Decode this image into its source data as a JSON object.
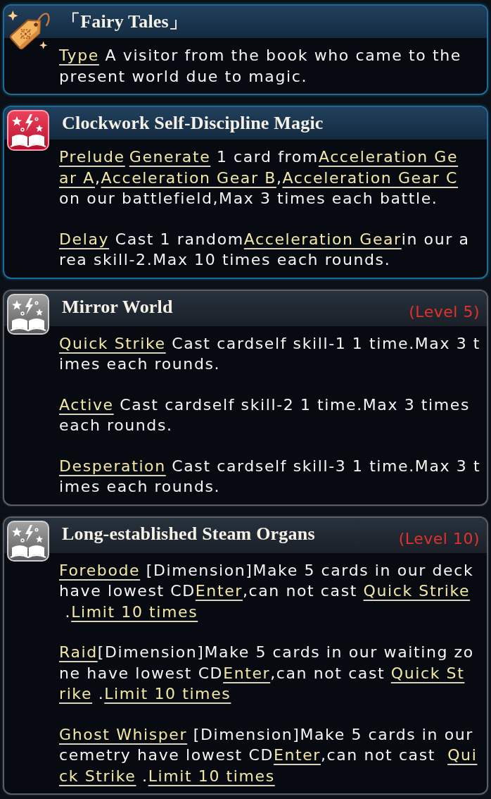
{
  "cards": [
    {
      "kind": "trait",
      "locked": false,
      "title": "「Fairy Tales」",
      "paragraphs": [
        {
          "lines": [
            [
              {
                "kind": "keyword",
                "text": "Type"
              },
              {
                "kind": "text",
                "text": " A visitor from the book who came to the"
              }
            ],
            [
              {
                "kind": "text",
                "text": "present world due to magic."
              }
            ]
          ]
        }
      ]
    },
    {
      "kind": "skill",
      "locked": false,
      "title": "Clockwork Self-Discipline Magic",
      "paragraphs": [
        {
          "lines": [
            [
              {
                "kind": "keyword",
                "text": "Prelude"
              },
              {
                "kind": "keyword",
                "text": "Generate"
              },
              {
                "kind": "text",
                "text": " 1 card from"
              },
              {
                "kind": "keyword",
                "text": "Acceleration Ge"
              }
            ],
            [
              {
                "kind": "keyword",
                "text": "ar A"
              },
              {
                "kind": "text",
                "text": ","
              },
              {
                "kind": "keyword",
                "text": "Acceleration Gear B"
              },
              {
                "kind": "text",
                "text": ","
              },
              {
                "kind": "keyword",
                "text": "Acceleration Gear C"
              }
            ],
            [
              {
                "kind": "text",
                "text": "on our battlefield,Max 3 times each battle."
              }
            ]
          ]
        },
        {
          "lines": [
            [
              {
                "kind": "keyword",
                "text": "Delay"
              },
              {
                "kind": "text",
                "text": " Cast 1 random"
              },
              {
                "kind": "keyword",
                "text": "Acceleration Gear"
              },
              {
                "kind": "text",
                "text": "in our a"
              }
            ],
            [
              {
                "kind": "text",
                "text": "rea skill-2.Max 10 times each rounds."
              }
            ]
          ]
        }
      ]
    },
    {
      "kind": "skill",
      "locked": true,
      "title": "Mirror World",
      "requirement": "(Level 5)",
      "paragraphs": [
        {
          "lines": [
            [
              {
                "kind": "keyword",
                "text": "Quick Strike"
              },
              {
                "kind": "text",
                "text": " Cast cardself skill-1 1 time.Max 3 t"
              }
            ],
            [
              {
                "kind": "text",
                "text": "imes each rounds."
              }
            ]
          ]
        },
        {
          "lines": [
            [
              {
                "kind": "keyword",
                "text": "Active"
              },
              {
                "kind": "text",
                "text": " Cast cardself skill-2 1 time.Max 3 times"
              }
            ],
            [
              {
                "kind": "text",
                "text": "each rounds."
              }
            ]
          ]
        },
        {
          "lines": [
            [
              {
                "kind": "keyword",
                "text": "Desperation"
              },
              {
                "kind": "text",
                "text": " Cast cardself skill-3 1 time.Max 3 t"
              }
            ],
            [
              {
                "kind": "text",
                "text": "imes each rounds."
              }
            ]
          ]
        }
      ]
    },
    {
      "kind": "skill",
      "locked": true,
      "title": "Long-established Steam Organs",
      "requirement": "(Level 10)",
      "paragraphs": [
        {
          "lines": [
            [
              {
                "kind": "keyword",
                "text": "Forebode"
              },
              {
                "kind": "text",
                "text": " [Dimension]Make 5 cards in our deck"
              }
            ],
            [
              {
                "kind": "text",
                "text": "have lowest CD"
              },
              {
                "kind": "keyword",
                "text": "Enter"
              },
              {
                "kind": "text",
                "text": ",can not cast "
              },
              {
                "kind": "keyword",
                "text": "Quick Strike"
              }
            ],
            [
              {
                "kind": "text",
                "text": " ."
              },
              {
                "kind": "keyword",
                "text": "Limit 10 times"
              }
            ]
          ]
        },
        {
          "lines": [
            [
              {
                "kind": "keyword",
                "text": "Raid"
              },
              {
                "kind": "text",
                "text": "[Dimension]Make 5 cards in our waiting zo"
              }
            ],
            [
              {
                "kind": "text",
                "text": "ne have lowest CD"
              },
              {
                "kind": "keyword",
                "text": "Enter"
              },
              {
                "kind": "text",
                "text": ",can not cast "
              },
              {
                "kind": "keyword",
                "text": "Quick St"
              }
            ],
            [
              {
                "kind": "keyword",
                "text": "rike"
              },
              {
                "kind": "text",
                "text": " ."
              },
              {
                "kind": "keyword",
                "text": "Limit 10 times"
              }
            ]
          ]
        },
        {
          "lines": [
            [
              {
                "kind": "keyword",
                "text": "Ghost Whisper"
              },
              {
                "kind": "text",
                "text": " [Dimension]Make 5 cards in our"
              }
            ],
            [
              {
                "kind": "text",
                "text": "cemetry have lowest CD"
              },
              {
                "kind": "keyword",
                "text": "Enter"
              },
              {
                "kind": "text",
                "text": ",can not cast  "
              },
              {
                "kind": "keyword",
                "text": "Qui"
              }
            ],
            [
              {
                "kind": "keyword",
                "text": "ck Strike"
              },
              {
                "kind": "text",
                "text": " ."
              },
              {
                "kind": "keyword",
                "text": "Limit 10 times"
              }
            ]
          ]
        }
      ]
    }
  ]
}
